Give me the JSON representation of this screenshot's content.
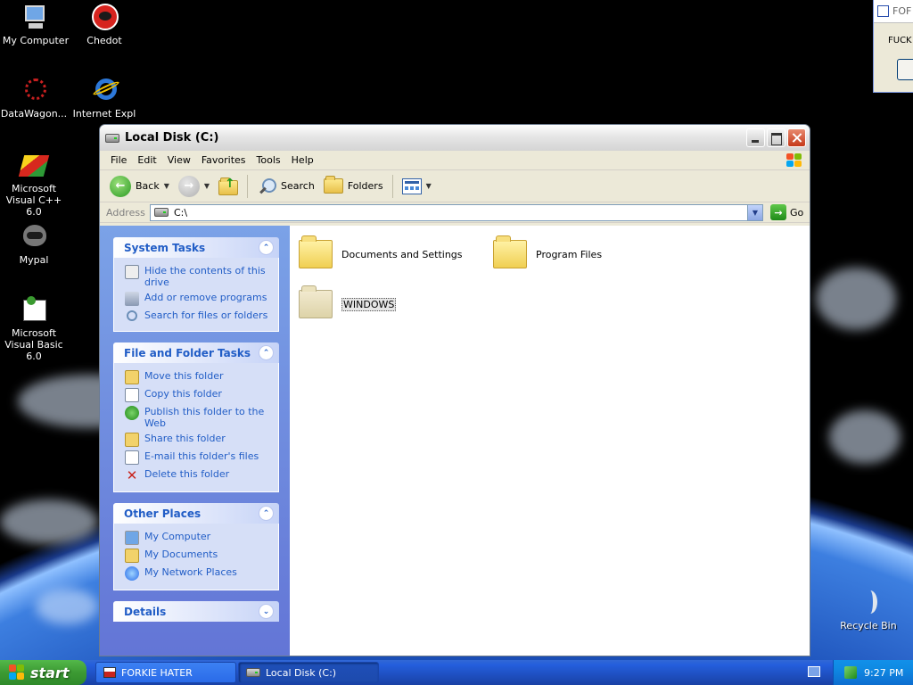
{
  "desktop": {
    "icons": [
      {
        "label": "My Computer"
      },
      {
        "label": "Chedot"
      },
      {
        "label": "DataWagon..."
      },
      {
        "label": "Internet Expl"
      },
      {
        "label": "Microsoft Visual C++ 6.0"
      },
      {
        "label": "Mypal"
      },
      {
        "label": "Microsoft Visual Basic 6.0"
      },
      {
        "label": "Recycle Bin"
      }
    ]
  },
  "partial_dialog": {
    "title": "FOF",
    "text": "FUCK"
  },
  "window": {
    "title": "Local Disk (C:)",
    "menu": [
      "File",
      "Edit",
      "View",
      "Favorites",
      "Tools",
      "Help"
    ],
    "toolbar": {
      "back": "Back",
      "search": "Search",
      "folders": "Folders"
    },
    "address": {
      "label": "Address",
      "value": "C:\\",
      "go": "Go"
    },
    "panels": {
      "system_tasks": {
        "title": "System Tasks",
        "items": [
          "Hide the contents of this drive",
          "Add or remove programs",
          "Search for files or folders"
        ]
      },
      "file_folder_tasks": {
        "title": "File and Folder Tasks",
        "items": [
          "Move this folder",
          "Copy this folder",
          "Publish this folder to the Web",
          "Share this folder",
          "E-mail this folder's files",
          "Delete this folder"
        ]
      },
      "other_places": {
        "title": "Other Places",
        "items": [
          "My Computer",
          "My Documents",
          "My Network Places"
        ]
      },
      "details": {
        "title": "Details"
      }
    },
    "files": [
      {
        "name": "Documents and Settings"
      },
      {
        "name": "Program Files"
      },
      {
        "name": "WINDOWS",
        "selected": true
      }
    ]
  },
  "taskbar": {
    "start": "start",
    "buttons": [
      {
        "label": "FORKIE HATER"
      },
      {
        "label": "Local Disk (C:)",
        "active": true
      }
    ],
    "clock": "9:27 PM"
  }
}
